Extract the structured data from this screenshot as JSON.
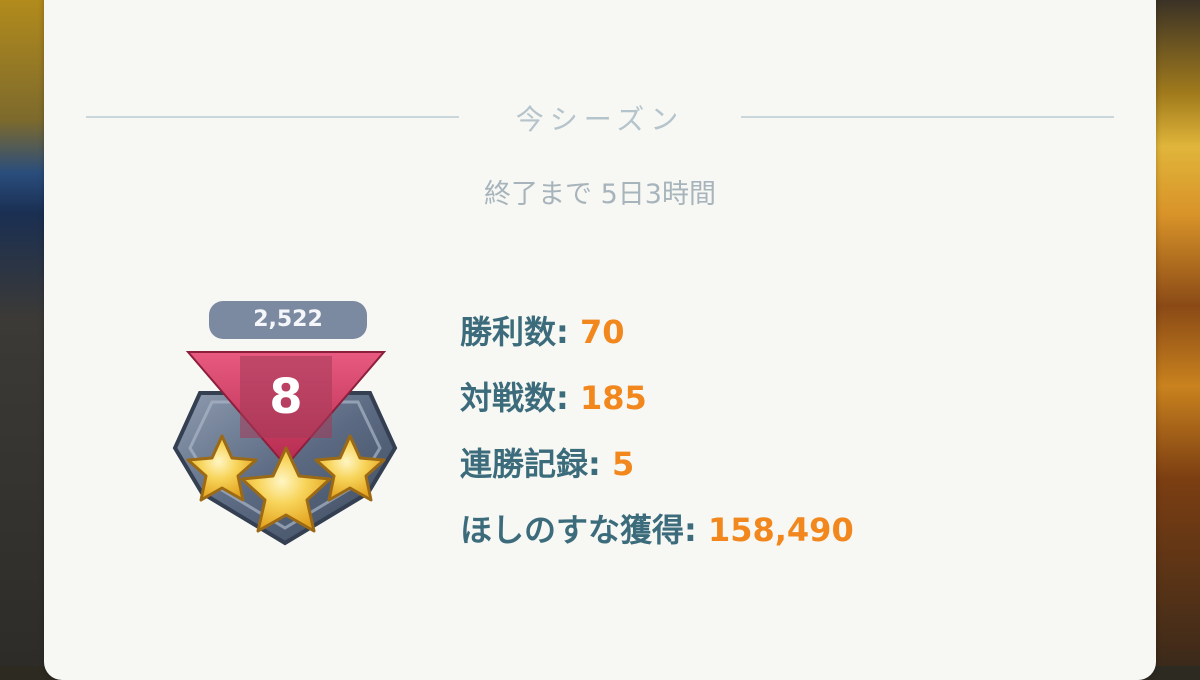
{
  "season": {
    "title": "今シーズン",
    "remaining": "終了まで 5日3時間"
  },
  "rank_badge": {
    "rating": "2,522",
    "rank": "8",
    "stars_filled": 3,
    "stars_total": 3
  },
  "stats": [
    {
      "label": "勝利数:",
      "value": "70"
    },
    {
      "label": "対戦数:",
      "value": "185"
    },
    {
      "label": "連勝記録:",
      "value": "5"
    },
    {
      "label": "ほしのすな獲得:",
      "value": "158,490"
    }
  ],
  "colors": {
    "label": "#3c6c7c",
    "value": "#f1871d",
    "rank_banner": "#c8375d",
    "rating_pill": "#7c8aa1",
    "star": "#f3c23c"
  }
}
